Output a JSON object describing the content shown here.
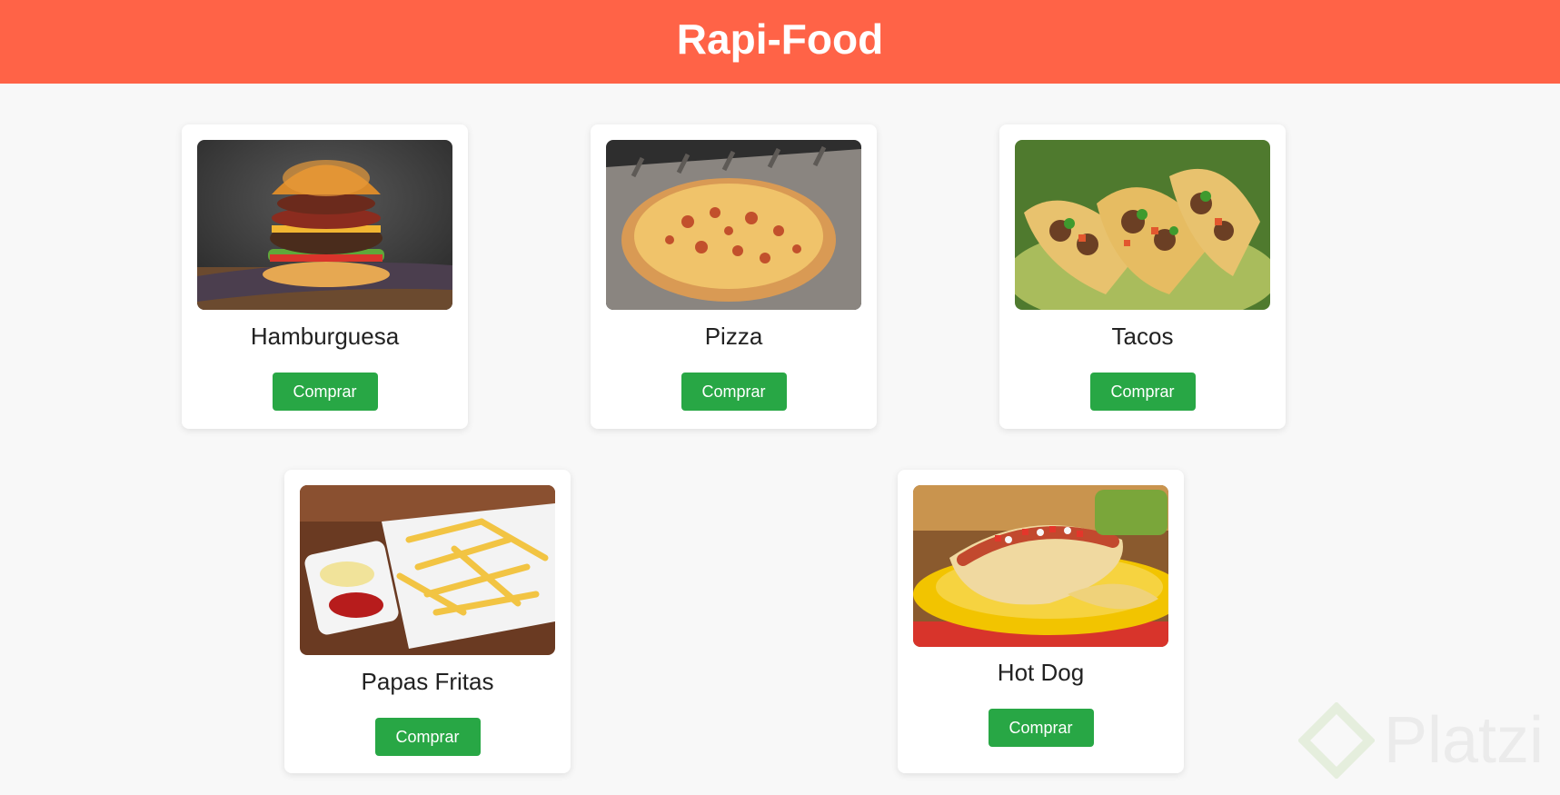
{
  "header": {
    "title": "Rapi-Food",
    "background": "#ff6347"
  },
  "products": [
    {
      "name": "Hamburguesa",
      "button_label": "Comprar",
      "image": "hamburger-image"
    },
    {
      "name": "Pizza",
      "button_label": "Comprar",
      "image": "pizza-image"
    },
    {
      "name": "Tacos",
      "button_label": "Comprar",
      "image": "tacos-image"
    },
    {
      "name": "Papas Fritas",
      "button_label": "Comprar",
      "image": "fries-image"
    },
    {
      "name": "Hot Dog",
      "button_label": "Comprar",
      "image": "hotdog-image"
    }
  ],
  "button_color": "#28a745",
  "watermark": {
    "text": "Platzi"
  }
}
